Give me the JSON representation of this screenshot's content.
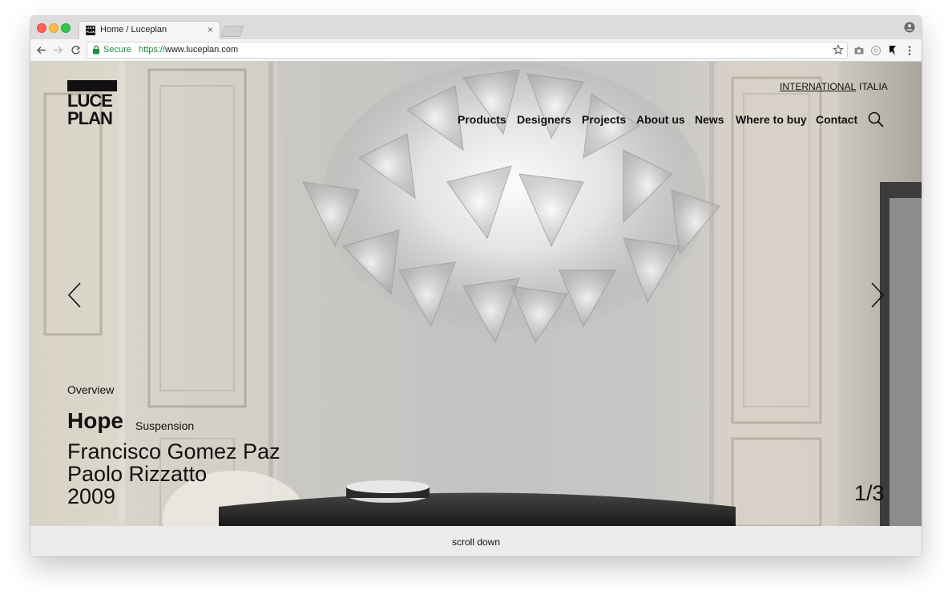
{
  "browser": {
    "tab_title": "Home / Luceplan",
    "tab_close": "×",
    "favicon_text": "LUCE PLAN",
    "secure_label": "Secure",
    "url_scheme": "https://",
    "url_host": "www.luceplan.com",
    "icons": [
      "back-icon",
      "forward-icon",
      "reload-icon",
      "lock-icon",
      "star-icon",
      "camera-icon",
      "extension-icon",
      "pointer-extension-icon",
      "menu-dots-icon",
      "profile-icon"
    ]
  },
  "site": {
    "logo": {
      "line1": "LUCE",
      "line2": "PLAN"
    },
    "languages": [
      "INTERNATIONAL",
      "ITALIA"
    ],
    "nav": [
      "Products",
      "Designers",
      "Projects",
      "About us",
      "News",
      "Where to buy",
      "Contact"
    ]
  },
  "hero": {
    "overview": "Overview",
    "product_name": "Hope",
    "product_type": "Suspension",
    "designers": [
      "Francisco Gomez Paz",
      "Paolo Rizzatto"
    ],
    "year": "2009",
    "counter": "1/3"
  },
  "footer": {
    "scroll_label": "scroll down"
  },
  "colors": {
    "text": "#111111",
    "secure_green": "#1e8e3e",
    "page_footer": "#ececec"
  }
}
